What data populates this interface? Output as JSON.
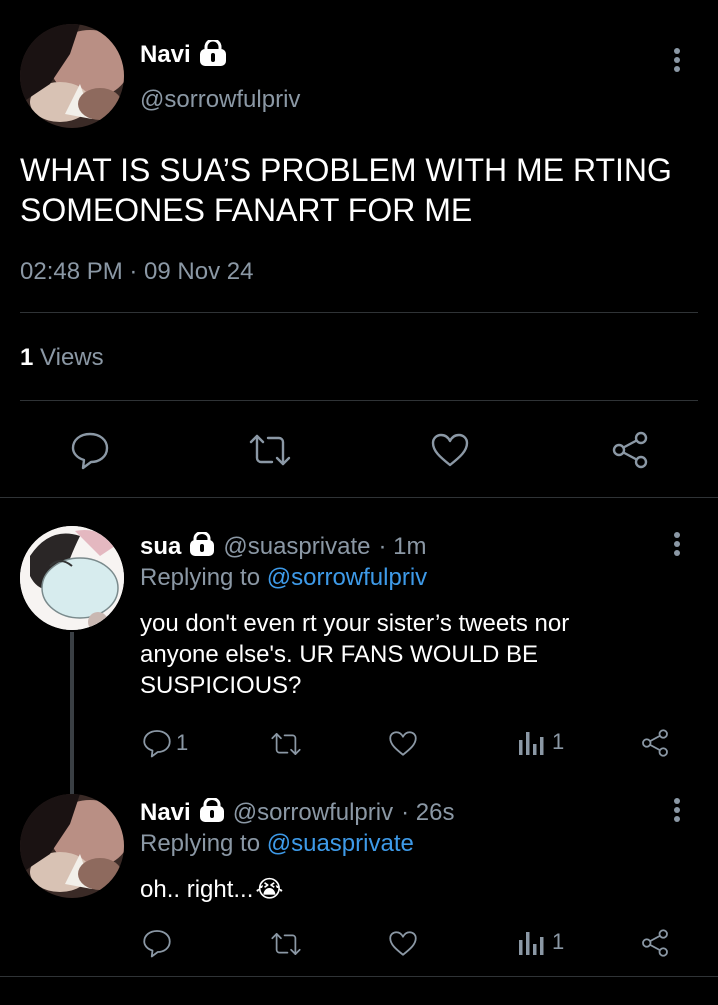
{
  "main_tweet": {
    "name": "Navi",
    "handle": "@sorrowfulpriv",
    "text_line1": "WHAT IS SUA’S PROBLEM WITH ME RTING",
    "text_line2": "SOMEONES FANART FOR ME",
    "timestamp": "02:48 PM · 09 Nov 24",
    "views_count": "1",
    "views_label": "Views",
    "actions": [
      "reply-icon",
      "retweet-icon",
      "like-icon",
      "share-icon"
    ]
  },
  "reply1": {
    "name": "sua",
    "handle": "@suasprivate",
    "time": "· 1m",
    "replying_prefix": "Replying to",
    "replying_to": "@sorrowfulpriv",
    "text_line1": "you don't even rt your sister’s tweets nor",
    "text_line2": "anyone else's. UR FANS WOULD BE",
    "text_line3": "SUSPICIOUS?",
    "reply_count": "1",
    "views_count": "1"
  },
  "reply2": {
    "name": "Navi",
    "handle": "@sorrowfulpriv",
    "time": "· 26s",
    "replying_prefix": "Replying to",
    "replying_to": "@suasprivate",
    "text": "oh.. right...",
    "emoji": "😭",
    "views_count": "1"
  },
  "colors": {
    "background": "#000000",
    "text": "#e7e9ea",
    "muted": "#8b98a5",
    "link": "#3e9ae8",
    "divider": "#2f3336"
  }
}
